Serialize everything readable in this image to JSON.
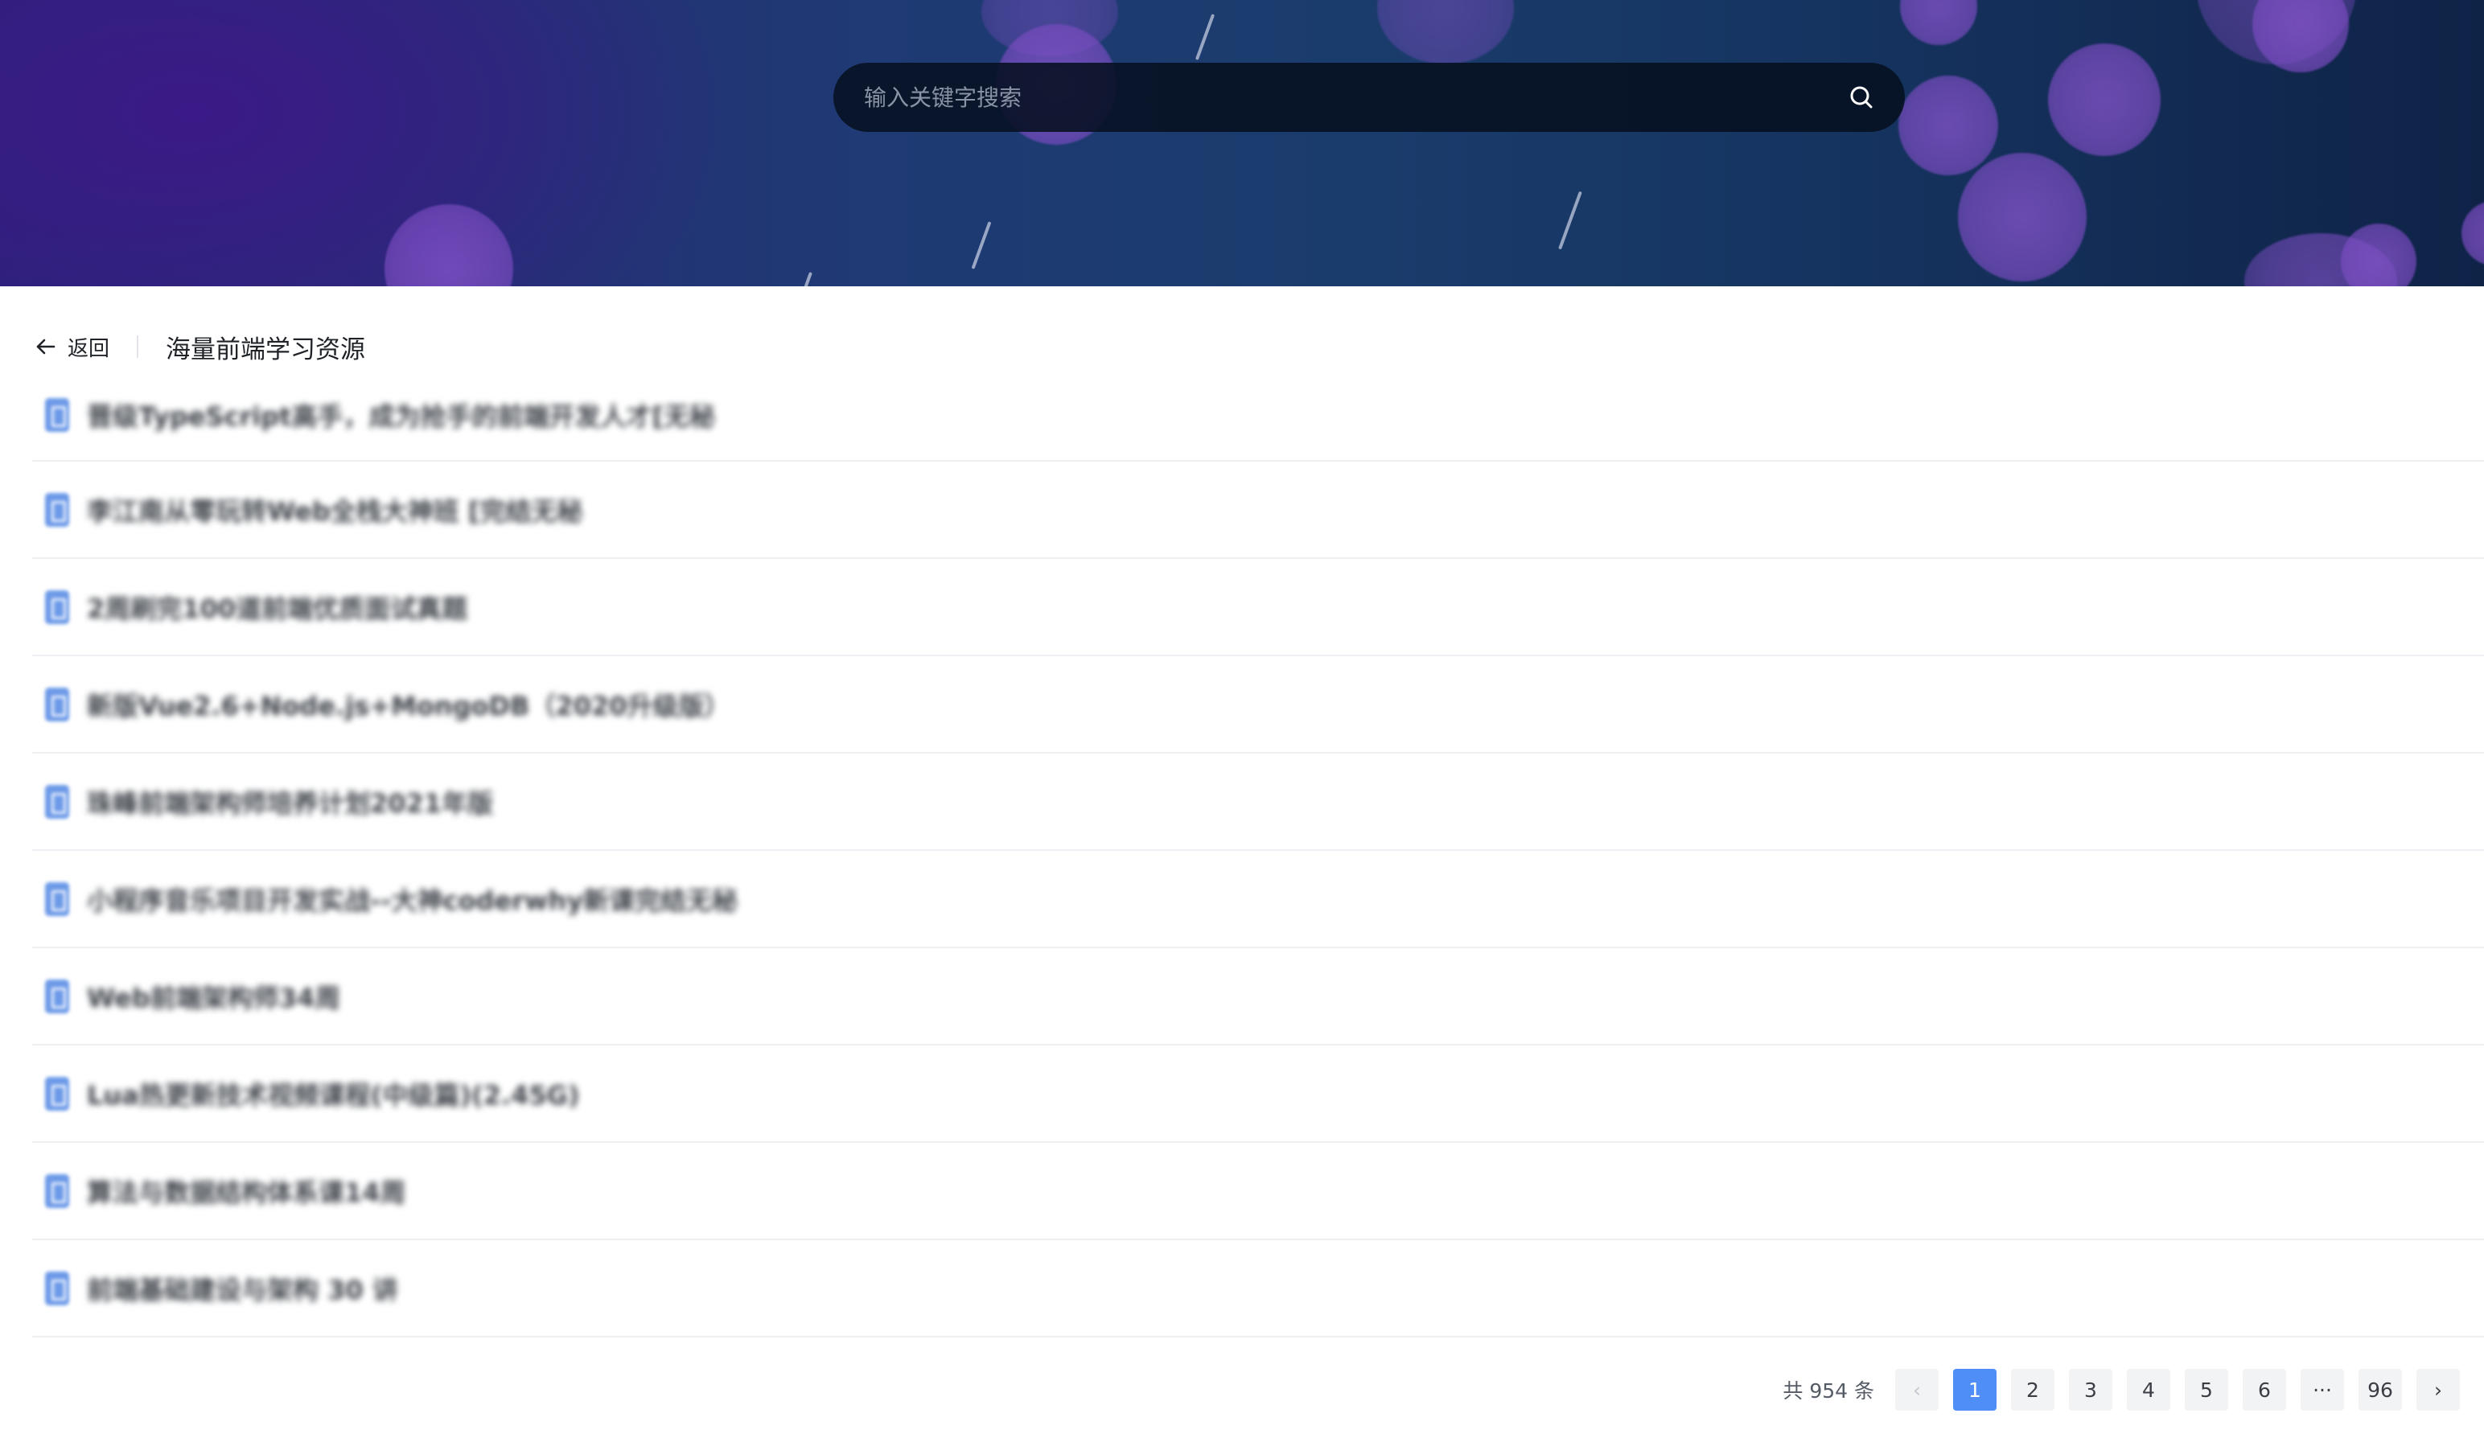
{
  "search": {
    "placeholder": "输入关键字搜索",
    "value": ""
  },
  "nav": {
    "back_label": "返回",
    "page_title": "海量前端学习资源"
  },
  "resources": [
    {
      "title": "晋级TypeScript高手，成为抢手的前端开发人才[无秘"
    },
    {
      "title": "李江南从零玩转Web全栈大神班 [完结无秘"
    },
    {
      "title": "2周刷完100道前端优质面试真题"
    },
    {
      "title": "新版Vue2.6+Node.js+MongoDB（2020升级版）"
    },
    {
      "title": "珠峰前端架构师培养计划2021年版"
    },
    {
      "title": "小程序音乐项目开发实战--大神coderwhy新课完结无秘"
    },
    {
      "title": "Web前端架构师34周"
    },
    {
      "title": "Lua热更新技术视频课程(中级篇)(2.45G)"
    },
    {
      "title": "算法与数据结构体系课14周"
    },
    {
      "title": "前端基础建设与架构 30 讲"
    }
  ],
  "pagination": {
    "total_text": "共 954 条",
    "prev": "‹",
    "next": "›",
    "pages": [
      "1",
      "2",
      "3",
      "4",
      "5",
      "6",
      "···",
      "96"
    ],
    "current": "1"
  },
  "colors": {
    "accent": "#4f8ef7",
    "file_icon": "#6d9ae8",
    "banner_dark": "#0f2347",
    "bubble": "#7d4ec4"
  },
  "icons": {
    "search": "search-icon",
    "back": "arrow-left-icon",
    "file": "file-icon"
  }
}
